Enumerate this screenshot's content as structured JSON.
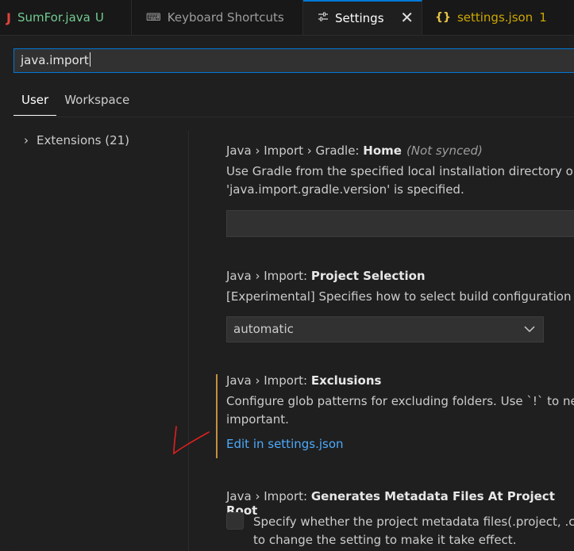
{
  "tabs": [
    {
      "icon": "J",
      "label": "SumFor.java",
      "status": "U"
    },
    {
      "icon": "⌨",
      "label": "Keyboard Shortcuts"
    },
    {
      "icon": "⚙",
      "label": "Settings",
      "close": "✕"
    },
    {
      "icon": "{}",
      "label": "settings.json",
      "count": "1"
    }
  ],
  "search": {
    "value": "java.import"
  },
  "scope_tabs": [
    "User",
    "Workspace"
  ],
  "toc": {
    "chevron": "›",
    "label": "Extensions (21)"
  },
  "settings": {
    "gradle_home": {
      "prefix": "Java › Import › Gradle: ",
      "name": "Home",
      "not_synced": "(Not synced)",
      "desc1": "Use Gradle from the specified local installation directory or GRADLE_HOME if the Gradle wrapper is missing or disabled and no",
      "desc2": "'java.import.gradle.version' is specified."
    },
    "project_selection": {
      "prefix": "Java › Import: ",
      "name": "Project Selection",
      "desc": "[Experimental] Specifies how to select build configuration files to import.",
      "value": "automatic"
    },
    "exclusions": {
      "prefix": "Java › Import: ",
      "name": "Exclusions",
      "desc1": "Configure glob patterns for excluding folders. Use `!` to negate patterns to allow subfolders imports. You have to include a parent directory. The order is",
      "desc2": "important.",
      "link": "Edit in settings.json"
    },
    "metadata": {
      "prefix": "Java › Import: ",
      "name": "Generates Metadata Files At Project Root",
      "desc1": "Specify whether the project metadata files(.project, .classpath, .factorypath, .settings/) will be generated at the project root. Click here to learn how",
      "desc2": "to change the setting to make it take effect."
    }
  },
  "colors": {
    "accent": "#0078d4",
    "link": "#4daafc",
    "modified": "#c48f3c",
    "untracked": "#73c991",
    "warning": "#cca700",
    "annotation": "#e02020"
  }
}
